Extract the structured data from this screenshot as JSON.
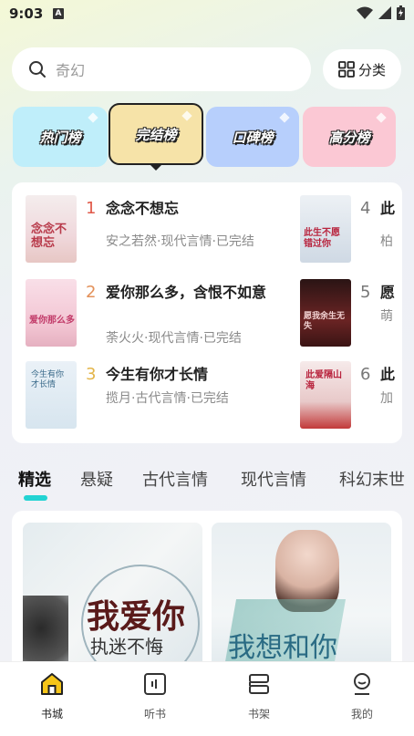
{
  "status": {
    "time": "9:03",
    "a_badge": "A"
  },
  "search": {
    "placeholder": "奇幻"
  },
  "category_button": {
    "label": "分类"
  },
  "rank_tabs": [
    {
      "label": "热门榜",
      "color": "#bfeefa"
    },
    {
      "label": "完结榜",
      "color": "#f6e3a8"
    },
    {
      "label": "口碑榜",
      "color": "#b7cffc"
    },
    {
      "label": "高分榜",
      "color": "#fbc8d4"
    }
  ],
  "rank_list": [
    {
      "rank": "1",
      "title": "念念不想忘",
      "meta": "安之若然·现代言情·已完结",
      "rank_color": "#e05a4a",
      "cover_text": "念念不想忘",
      "cover_color": "#f7e6e6"
    },
    {
      "rank": "2",
      "title": "爱你那么多，含恨不如意",
      "meta": "荼火火·现代言情·已完结",
      "rank_color": "#e3915a",
      "cover_text": "爱你那么多",
      "cover_color": "#f6d7e0"
    },
    {
      "rank": "3",
      "title": "今生有你才长情",
      "meta": "揽月·古代言情·已完结",
      "rank_color": "#e3b54a",
      "cover_text": "今生有你才长情",
      "cover_color": "#dfeaf3"
    },
    {
      "rank": "4",
      "title": "此",
      "meta": "柏",
      "rank_color": "#777",
      "cover_text": "此生不愿错过你",
      "cover_color": "#dfe7ee"
    },
    {
      "rank": "5",
      "title": "愿",
      "meta": "萌",
      "rank_color": "#777",
      "cover_text": "愿我余生无失",
      "cover_color": "#4a1e1e"
    },
    {
      "rank": "6",
      "title": "此",
      "meta": "加",
      "rank_color": "#777",
      "cover_text": "此爱隔山海",
      "cover_color": "#f1dede"
    }
  ],
  "genre_tabs": [
    "精选",
    "悬疑",
    "古代言情",
    "现代言情",
    "科幻末世"
  ],
  "featured": [
    {
      "text_big": "我爱你",
      "text_small": "执迷不悔",
      "bg": "#e8eef0"
    },
    {
      "text_big": "我想和你",
      "text_small": "",
      "bg": "#e6eef2"
    }
  ],
  "bottom_nav": [
    {
      "label": "书城",
      "icon": "home-icon"
    },
    {
      "label": "听书",
      "icon": "audio-book-icon"
    },
    {
      "label": "书架",
      "icon": "bookshelf-icon"
    },
    {
      "label": "我的",
      "icon": "profile-icon"
    }
  ],
  "colors": {
    "accent": "#22d3d3",
    "home_icon": "#f5c518"
  }
}
